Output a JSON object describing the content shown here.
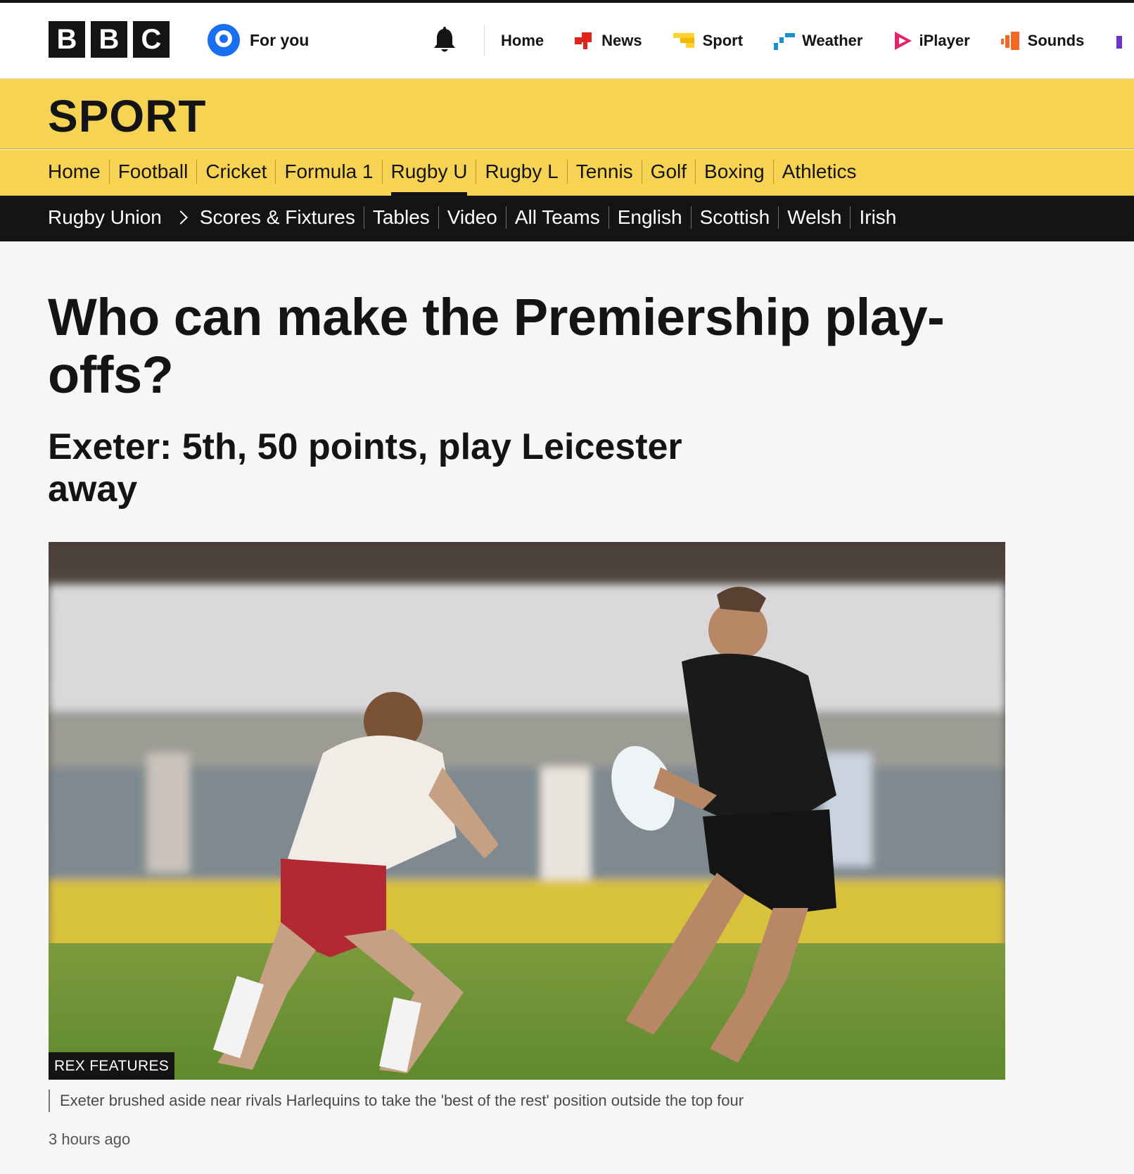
{
  "global_header": {
    "logo_letters": [
      "B",
      "B",
      "C"
    ],
    "for_you_label": "For you",
    "nav": [
      {
        "label": "Home",
        "icon": "none"
      },
      {
        "label": "News",
        "icon": "news-icon",
        "color": "#e2231a"
      },
      {
        "label": "Sport",
        "icon": "sport-icon",
        "color": "#ffd230"
      },
      {
        "label": "Weather",
        "icon": "weather-icon",
        "color": "#1d8fcb"
      },
      {
        "label": "iPlayer",
        "icon": "iplayer-icon",
        "color": "#e4256c"
      },
      {
        "label": "Sounds",
        "icon": "sounds-icon",
        "color": "#f26724"
      }
    ]
  },
  "sport": {
    "title": "SPORT",
    "nav": [
      "Home",
      "Football",
      "Cricket",
      "Formula 1",
      "Rugby U",
      "Rugby L",
      "Tennis",
      "Golf",
      "Boxing",
      "Athletics"
    ],
    "active": "Rugby U"
  },
  "section_nav": {
    "root": "Rugby Union",
    "items": [
      "Scores & Fixtures",
      "Tables",
      "Video",
      "All Teams",
      "English",
      "Scottish",
      "Welsh",
      "Irish"
    ]
  },
  "article": {
    "headline": "Who can make the Premiership play-offs?",
    "subheading": "Exeter: 5th, 50 points, play Leicester away",
    "image_credit": "REX FEATURES",
    "caption": "Exeter brushed aside near rivals Harlequins to take the 'best of the rest' position outside the top four",
    "timestamp": "3 hours ago"
  },
  "colors": {
    "sport_yellow": "#f7d353",
    "nav_black": "#141414",
    "for_you_blue": "#1a6ef0"
  }
}
